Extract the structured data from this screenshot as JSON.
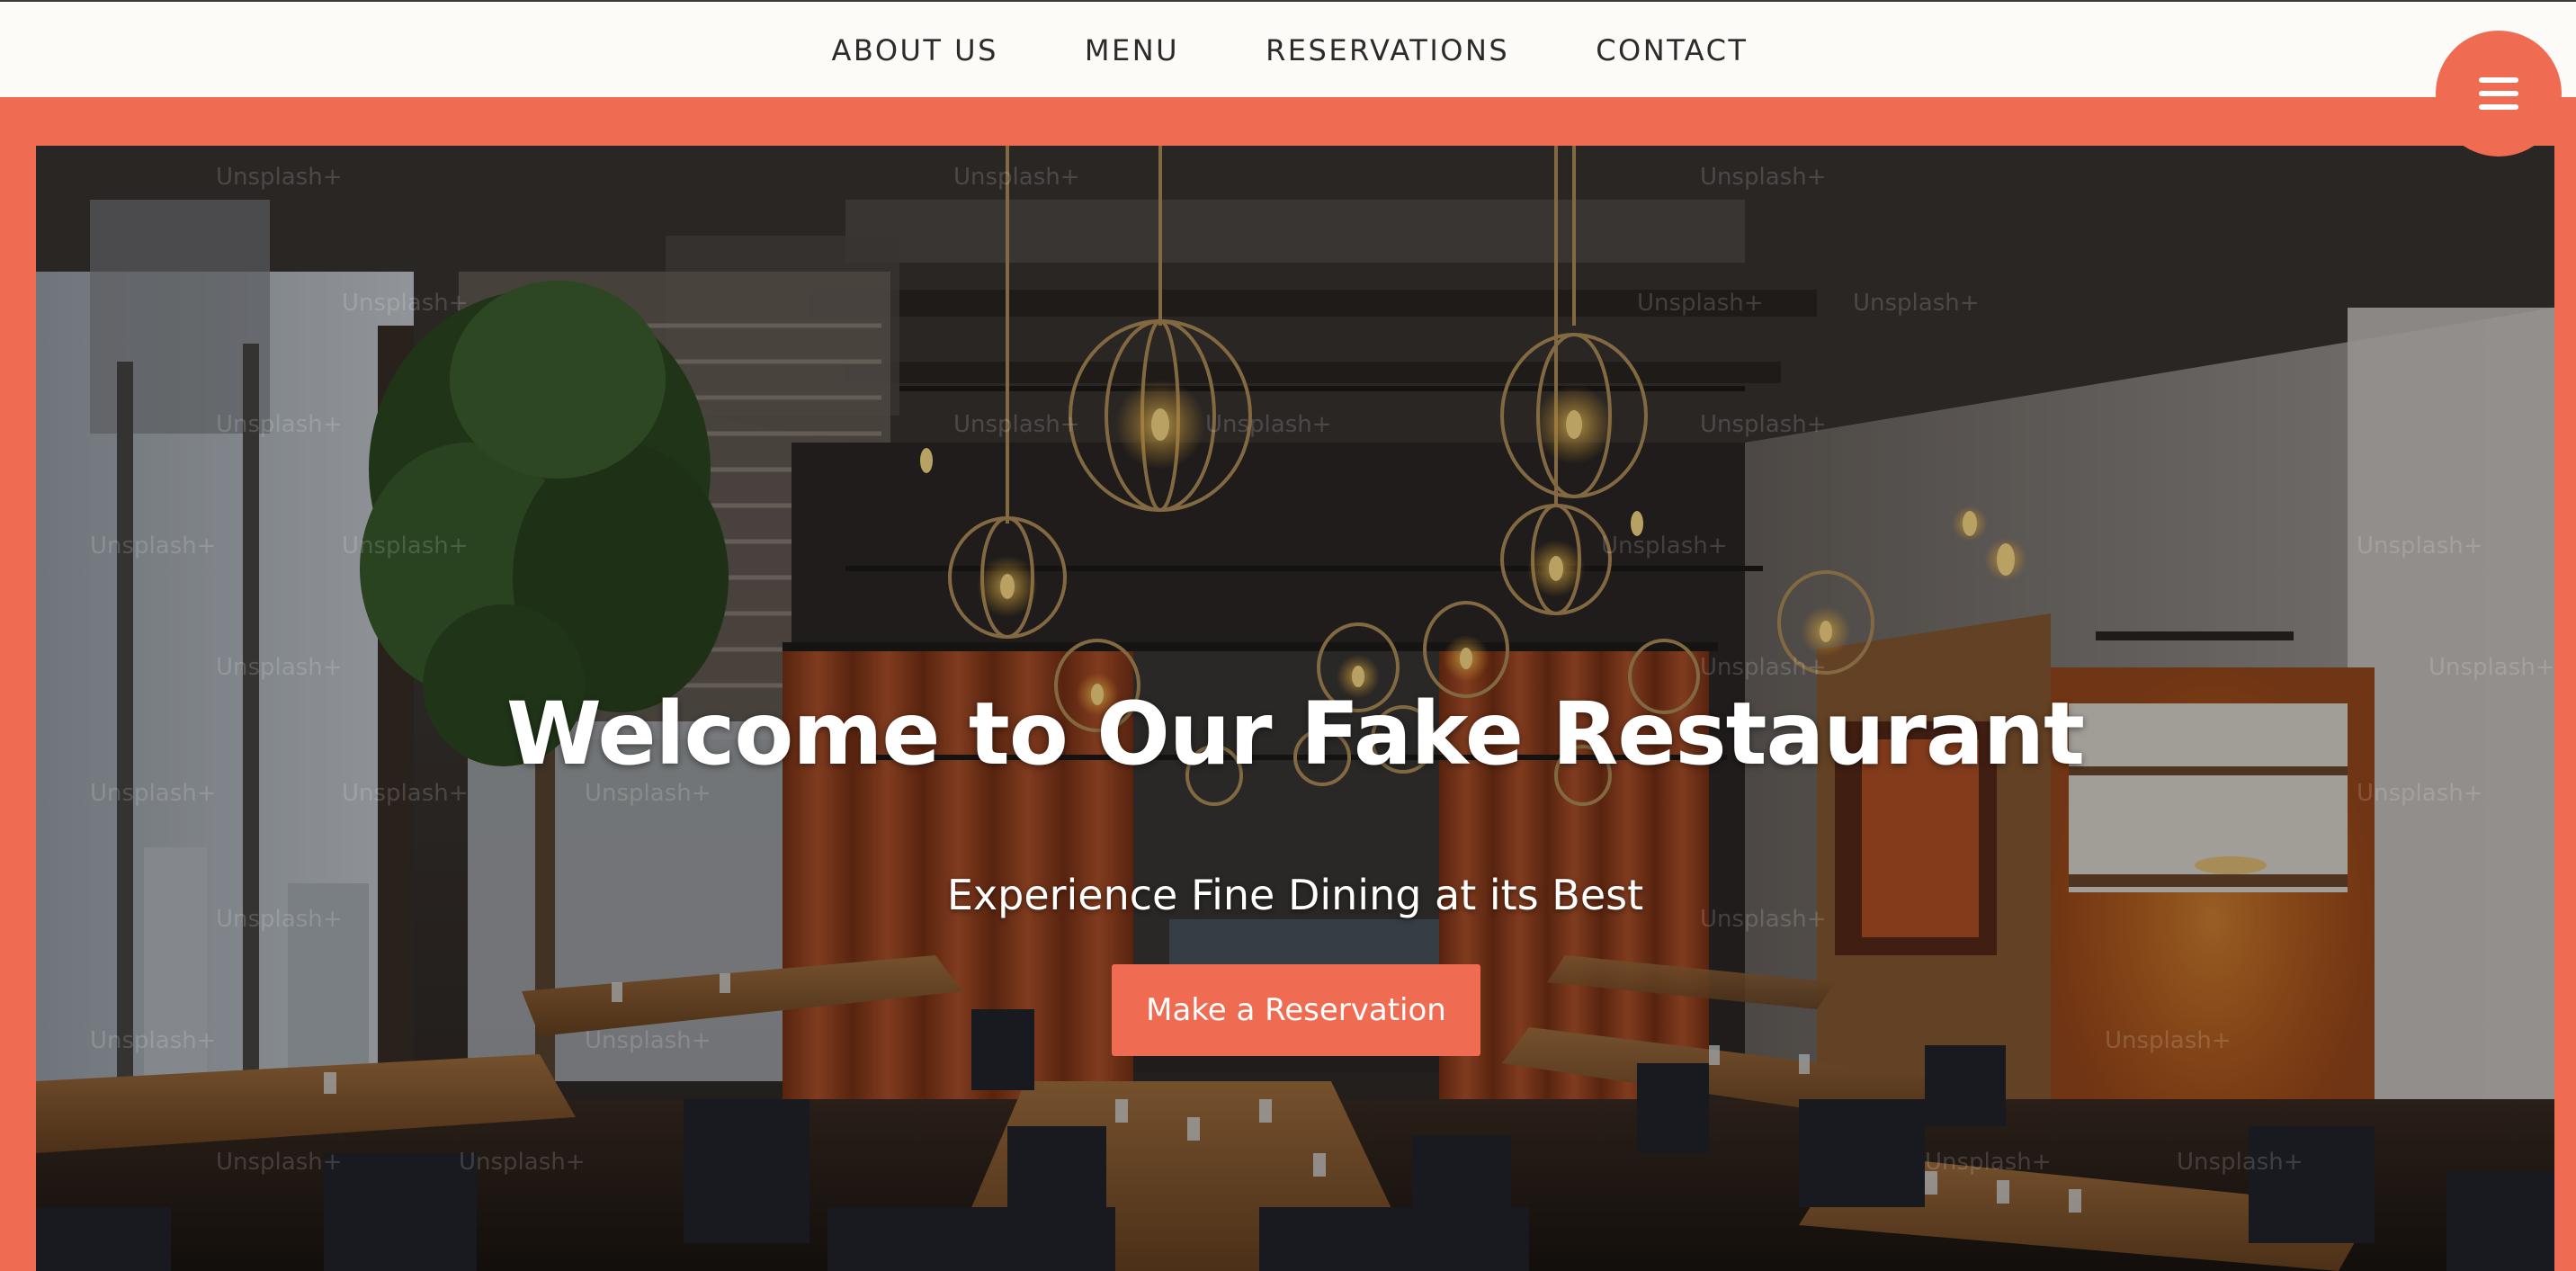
{
  "nav": {
    "links": [
      {
        "label": "ABOUT US"
      },
      {
        "label": "MENU"
      },
      {
        "label": "RESERVATIONS"
      },
      {
        "label": "CONTACT"
      }
    ],
    "menu_icon": "hamburger-menu-icon"
  },
  "hero": {
    "title": "Welcome to Our Fake Restaurant",
    "subtitle": "Experience Fine Dining at its Best",
    "cta_label": "Make a Reservation",
    "watermark_text": "Unsplash+"
  },
  "colors": {
    "accent": "#ef6c52",
    "nav_background": "#fdfbf8",
    "nav_text": "#2b2b2b",
    "hero_text": "#ffffff"
  }
}
